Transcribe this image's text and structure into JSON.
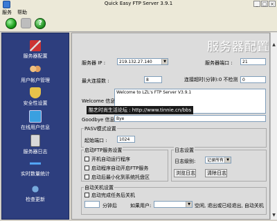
{
  "window": {
    "title": "Quick Easy FTP Server 3.9.1",
    "minimize": "_",
    "maximize": "□",
    "close": "×"
  },
  "menu": {
    "items": [
      {
        "label": "服务"
      },
      {
        "label": "帮助"
      }
    ]
  },
  "toolbar": {
    "help_label": "?"
  },
  "sidebar": {
    "items": [
      {
        "label": "服务器配置"
      },
      {
        "label": "用户帐户管理"
      },
      {
        "label": "安全性设置"
      },
      {
        "label": "在线用户信息"
      },
      {
        "label": "服务器日志"
      },
      {
        "label": "实时数量统计"
      },
      {
        "label": "检查更新"
      }
    ]
  },
  "main": {
    "title": "服务器配置",
    "server_ip_label": "服务器 IP :",
    "server_ip_value": "219.132.27.140",
    "server_port_label": "服务器端口 :",
    "server_port_value": "21",
    "max_conn_label": "最大连接数 :",
    "max_conn_value": "8",
    "timeout_label": "连接超时(分钟):0 不检测",
    "timeout_value": "0",
    "welcome_label": "Welcome 信息:",
    "welcome_value": "Welcome to LZL's FTP Server V3.9.1",
    "goodbye_label": "Goodbye 信息:",
    "goodbye_value": "Bye",
    "pasv_group": "PASV模式设置",
    "start_port_label": "起始端口 :",
    "start_port_value": "1024",
    "ftp_group": "启动FTP服务设置",
    "ftp_opt1": "开机自动运行程序",
    "ftp_opt2": "启动程序自动开启FTP服务",
    "ftp_opt3": "启动后最小化到系统托盘区",
    "log_group": "日志设置",
    "log_level_label": "日志级别:",
    "log_level_value": "记录所有",
    "browse_log_button": "浏览日志",
    "clear_log_button": "清除日志",
    "shutdown_group": "自动关机设置",
    "shutdown_opt": "启动完成任务后关机",
    "minutes_after": "分钟后",
    "if_user": "如果用户:",
    "idle_text": "空闲, 退出或已经退出, 自动关机"
  },
  "watermark": "酷艺时尚生活论坛 : http://www.tinnie.cn/bbs"
}
